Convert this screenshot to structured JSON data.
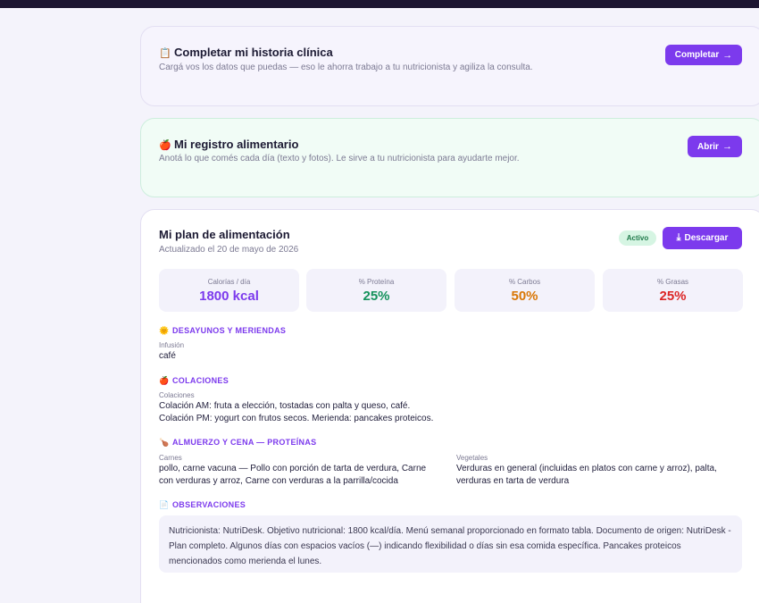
{
  "historia": {
    "emoji": "📋",
    "title": "Completar mi historia clínica",
    "desc": "Cargá vos los datos que puedas — eso le ahorra trabajo a tu nutricionista y agiliza la consulta.",
    "button": "Completar",
    "button_arrow": "→"
  },
  "registro": {
    "emoji": "🍎",
    "title": "Mi registro alimentario",
    "desc": "Anotá lo que comés cada día (texto y fotos). Le sirve a tu nutricionista para ayudarte mejor.",
    "button": "Abrir",
    "button_arrow": "→"
  },
  "plan": {
    "title": "Mi plan de alimentación",
    "updated": "Actualizado el 20 de mayo de 2026",
    "badge": "Activo",
    "download_icon": "⤓",
    "download": "Descargar",
    "stats": [
      {
        "label": "Calorías / día",
        "value": "1800 kcal",
        "color": "#7c3aed"
      },
      {
        "label": "% Proteína",
        "value": "25%",
        "color": "#15925c"
      },
      {
        "label": "% Carbos",
        "value": "50%",
        "color": "#d97706"
      },
      {
        "label": "% Grasas",
        "value": "25%",
        "color": "#dc2626"
      }
    ],
    "sections": {
      "desayunos": {
        "emoji": "🌞",
        "title": "DESAYUNOS Y MERIENDAS",
        "label": "Infusión",
        "text": "café"
      },
      "colaciones": {
        "emoji": "🍎",
        "title": "COLACIONES",
        "label": "Colaciones",
        "line1": "Colación AM: fruta a elección, tostadas con palta y queso, café.",
        "line2": "Colación PM: yogurt con frutos secos. Merienda: pancakes proteicos."
      },
      "almuerzo": {
        "emoji": "🍗",
        "title": "ALMUERZO Y CENA — PROTEÍNAS",
        "carnes_label": "Carnes",
        "carnes_line1": "pollo, carne vacuna — Pollo con porción de tarta de verdura, Carne",
        "carnes_line2": "con verduras y arroz, Carne con verduras a la parrilla/cocida",
        "vegetales_label": "Vegetales",
        "vegetales_line1": "Verduras en general (incluidas en platos con carne y arroz), palta,",
        "vegetales_line2": "verduras en tarta de verdura"
      },
      "observaciones": {
        "emoji": "📄",
        "title": "OBSERVACIONES",
        "text": "Nutricionista: NutriDesk. Objetivo nutricional: 1800 kcal/día. Menú semanal proporcionado en formato tabla. Documento de origen: NutriDesk - Plan completo. Algunos días con espacios vacíos (—) indicando flexibilidad o días sin esa comida específica. Pancakes proteicos mencionados como merienda el lunes."
      }
    }
  }
}
